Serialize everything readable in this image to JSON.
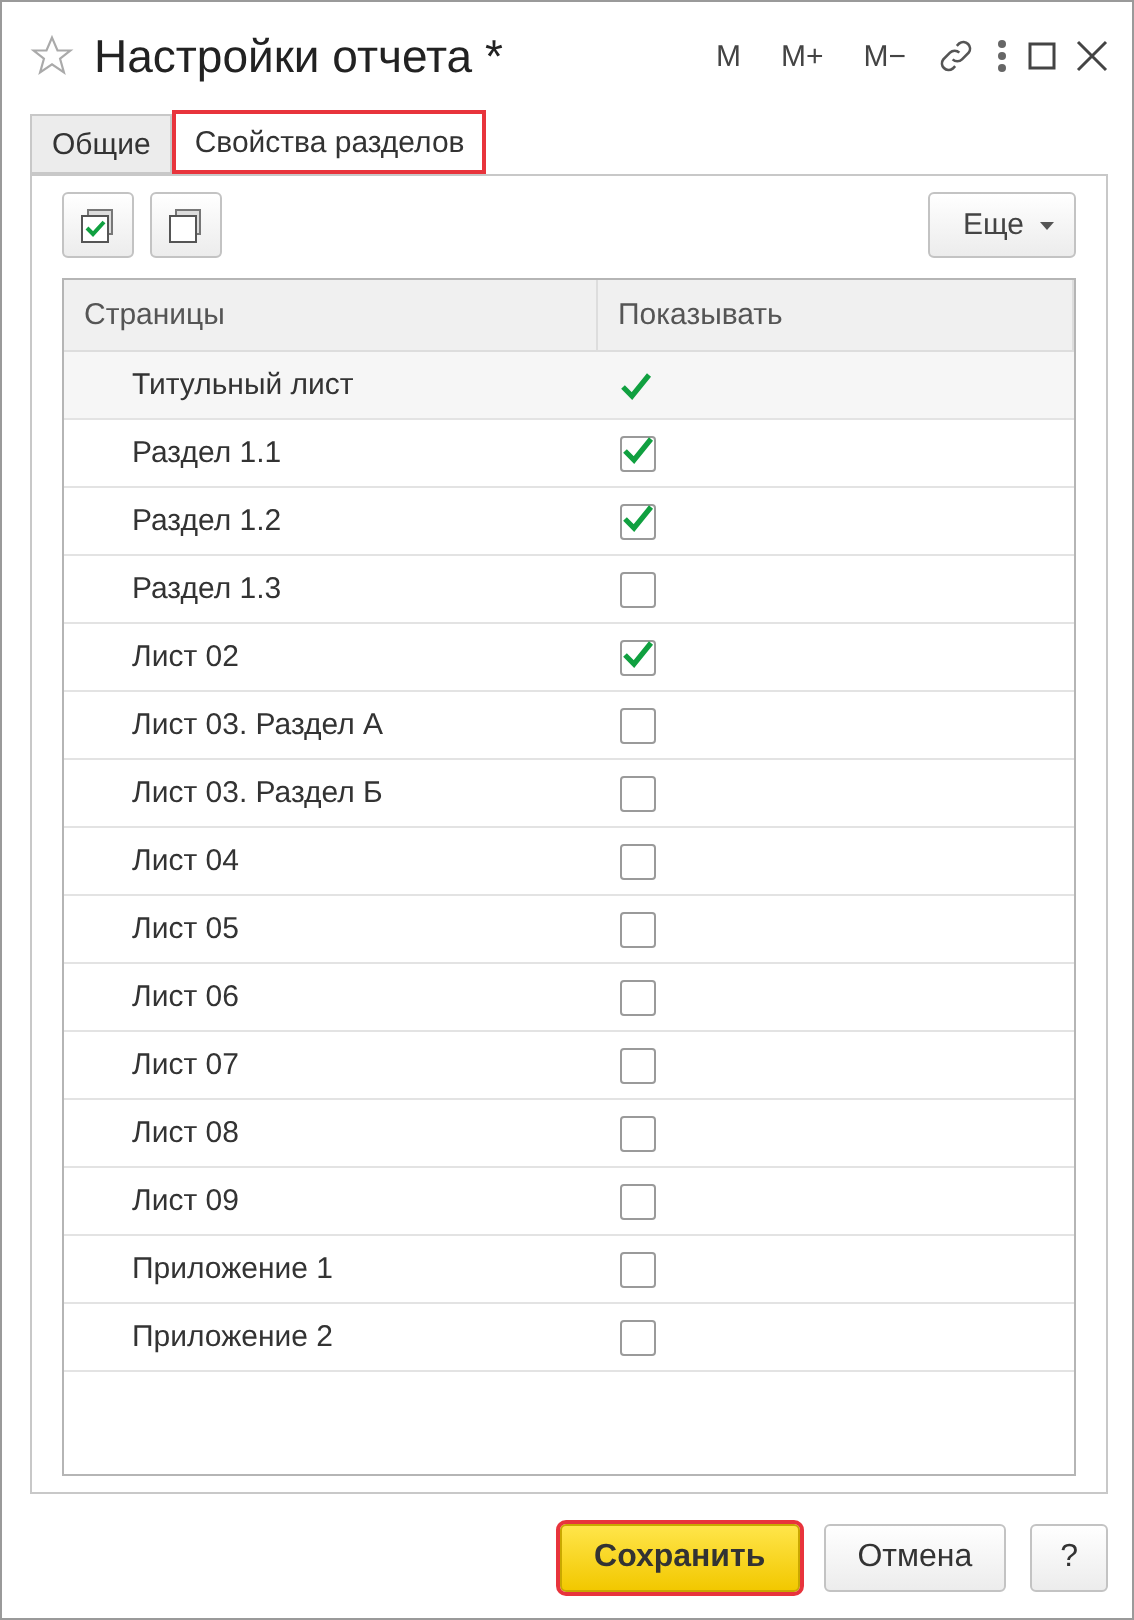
{
  "window": {
    "title": "Настройки отчета *",
    "header_buttons": [
      "M",
      "M+",
      "M−"
    ]
  },
  "tabs": [
    {
      "label": "Общие",
      "selected": false,
      "highlighted": false
    },
    {
      "label": "Свойства разделов",
      "selected": true,
      "highlighted": true
    }
  ],
  "toolbar": {
    "more_button": "Еще"
  },
  "table": {
    "columns": [
      "Страницы",
      "Показывать"
    ],
    "rows": [
      {
        "kind": "group",
        "name": "Титульный лист",
        "checked": true
      },
      {
        "kind": "item",
        "name": "Раздел 1.1",
        "checked": true
      },
      {
        "kind": "item",
        "name": "Раздел 1.2",
        "checked": true
      },
      {
        "kind": "item",
        "name": "Раздел 1.3",
        "checked": false
      },
      {
        "kind": "item",
        "name": "Лист 02",
        "checked": true
      },
      {
        "kind": "item",
        "name": "Лист 03. Раздел А",
        "checked": false
      },
      {
        "kind": "item",
        "name": "Лист 03. Раздел Б",
        "checked": false
      },
      {
        "kind": "item",
        "name": "Лист 04",
        "checked": false
      },
      {
        "kind": "item",
        "name": "Лист 05",
        "checked": false
      },
      {
        "kind": "item",
        "name": "Лист 06",
        "checked": false
      },
      {
        "kind": "item",
        "name": "Лист 07",
        "checked": false
      },
      {
        "kind": "item",
        "name": "Лист 08",
        "checked": false
      },
      {
        "kind": "item",
        "name": "Лист 09",
        "checked": false
      },
      {
        "kind": "item",
        "name": "Приложение 1",
        "checked": false
      },
      {
        "kind": "item",
        "name": "Приложение 2",
        "checked": false
      }
    ]
  },
  "footer": [
    {
      "kind": "primary",
      "label": "Сохранить",
      "highlighted": true
    },
    {
      "kind": "normal",
      "label": "Отмена",
      "highlighted": false
    },
    {
      "kind": "help",
      "label": "?",
      "highlighted": false
    }
  ]
}
